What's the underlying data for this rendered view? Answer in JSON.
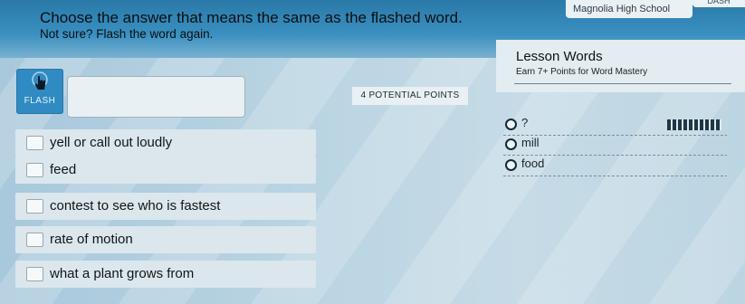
{
  "header": {
    "school": "Magnolia High School",
    "dash": "DASH",
    "title": "Choose the answer that means the same as the flashed word.",
    "subtitle": "Not sure? Flash the word again."
  },
  "lesson": {
    "title": "Lesson Words",
    "subtitle": "Earn 7+ Points for Word Mastery"
  },
  "flash": {
    "label": "FLASH"
  },
  "points": {
    "label": "4 POTENTIAL POINTS"
  },
  "choices": [
    {
      "label": "yell or call out loudly"
    },
    {
      "label": "feed"
    },
    {
      "label": "contest to see who is fastest"
    },
    {
      "label": "rate of motion"
    },
    {
      "label": "what a plant grows from"
    }
  ],
  "lesson_words": [
    {
      "text": "?"
    },
    {
      "text": "mill"
    },
    {
      "text": "food"
    }
  ]
}
